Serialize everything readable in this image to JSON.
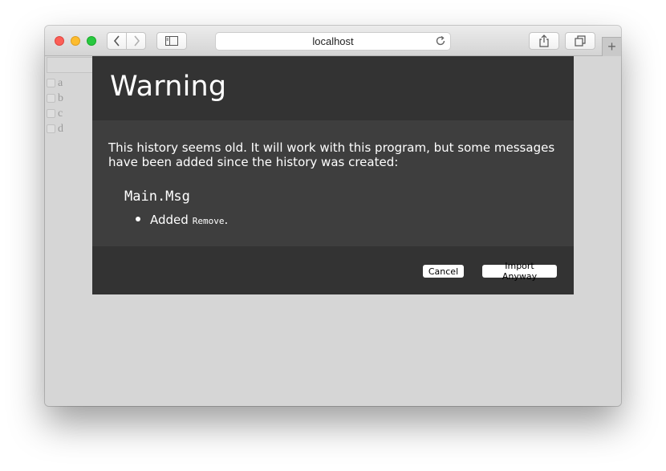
{
  "browser": {
    "url": "localhost"
  },
  "page": {
    "items": [
      {
        "label": "a"
      },
      {
        "label": "b"
      },
      {
        "label": "c"
      },
      {
        "label": "d"
      }
    ]
  },
  "dialog": {
    "title": "Warning",
    "message": "This history seems old. It will work with this program, but some messages have been added since the history was created:",
    "module": "Main.Msg",
    "change_prefix": "Added",
    "change_code": "Remove",
    "change_suffix": ".",
    "cancel_label": "Cancel",
    "import_label": "Import Anyway"
  },
  "colors": {
    "dialog_header": "#333333",
    "dialog_body": "#3e3e3e",
    "page_background": "#d6d6d6"
  }
}
